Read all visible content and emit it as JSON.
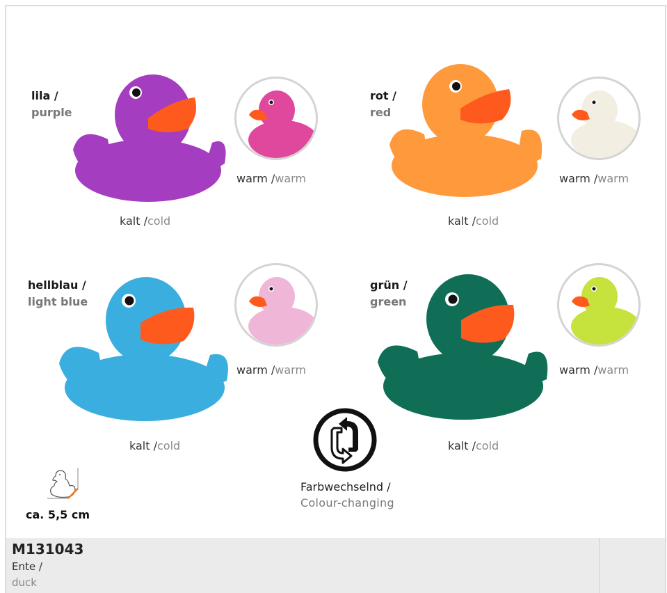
{
  "colors": {
    "accent_orange": "#f07a1c",
    "beak": "#ff5a1e",
    "frame": "#dcdcdc",
    "footer_bg": "#ebebeb"
  },
  "variants": [
    {
      "name_de": "lila /",
      "name_en": "purple",
      "cold_color": "#a53dc0",
      "warm_color": "#e0489e",
      "cold_de": "kalt /",
      "cold_en": "cold",
      "warm_de": "warm /",
      "warm_en": "warm"
    },
    {
      "name_de": "rot /",
      "name_en": "red",
      "cold_color": "#ff9a3c",
      "warm_color": "#f3eee2",
      "cold_de": "kalt /",
      "cold_en": "cold",
      "warm_de": "warm /",
      "warm_en": "warm"
    },
    {
      "name_de": "hellblau /",
      "name_en": "light blue",
      "cold_color": "#3aaede",
      "warm_color": "#f0b6d8",
      "cold_de": "kalt /",
      "cold_en": "cold",
      "warm_de": "warm /",
      "warm_en": "warm"
    },
    {
      "name_de": "grün /",
      "name_en": "green",
      "cold_color": "#0f6e55",
      "warm_color": "#c6e23c",
      "cold_de": "kalt /",
      "cold_en": "cold",
      "warm_de": "warm /",
      "warm_en": "warm"
    }
  ],
  "feature": {
    "label_de": "Farbwechselnd /",
    "label_en": "Colour-changing",
    "icon": "colour-change-icon"
  },
  "size": {
    "label": "ca. 5,5 cm",
    "icon": "duck-size-icon"
  },
  "footer": {
    "article_no": "M131043",
    "type_de": "Ente /",
    "type_en": "duck"
  }
}
